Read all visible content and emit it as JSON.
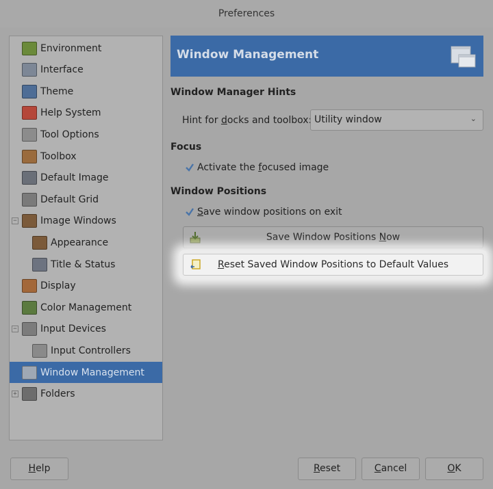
{
  "window": {
    "title": "Preferences"
  },
  "tree": {
    "items": [
      {
        "label": "Environment",
        "icon": "environment-icon",
        "indent": 0,
        "expander": ""
      },
      {
        "label": "Interface",
        "icon": "interface-icon",
        "indent": 0,
        "expander": ""
      },
      {
        "label": "Theme",
        "icon": "theme-icon",
        "indent": 0,
        "expander": ""
      },
      {
        "label": "Help System",
        "icon": "help-system-icon",
        "indent": 0,
        "expander": ""
      },
      {
        "label": "Tool Options",
        "icon": "tool-options-icon",
        "indent": 0,
        "expander": ""
      },
      {
        "label": "Toolbox",
        "icon": "toolbox-icon",
        "indent": 0,
        "expander": ""
      },
      {
        "label": "Default Image",
        "icon": "default-image-icon",
        "indent": 0,
        "expander": ""
      },
      {
        "label": "Default Grid",
        "icon": "default-grid-icon",
        "indent": 0,
        "expander": ""
      },
      {
        "label": "Image Windows",
        "icon": "image-windows-icon",
        "indent": 0,
        "expander": "−"
      },
      {
        "label": "Appearance",
        "icon": "appearance-icon",
        "indent": 1,
        "expander": ""
      },
      {
        "label": "Title & Status",
        "icon": "title-status-icon",
        "indent": 1,
        "expander": ""
      },
      {
        "label": "Display",
        "icon": "display-icon",
        "indent": 0,
        "expander": ""
      },
      {
        "label": "Color Management",
        "icon": "color-management-icon",
        "indent": 0,
        "expander": ""
      },
      {
        "label": "Input Devices",
        "icon": "input-devices-icon",
        "indent": 0,
        "expander": "−"
      },
      {
        "label": "Input Controllers",
        "icon": "input-controllers-icon",
        "indent": 1,
        "expander": ""
      },
      {
        "label": "Window Management",
        "icon": "window-management-icon",
        "indent": 0,
        "expander": "",
        "selected": true
      },
      {
        "label": "Folders",
        "icon": "folders-icon",
        "indent": 0,
        "expander": "+"
      }
    ]
  },
  "banner": {
    "title": "Window Management",
    "icon": "window-management-icon"
  },
  "hints": {
    "section": "Window Manager Hints",
    "label_pre": "Hint for ",
    "label_mn": "d",
    "label_post": "ocks and toolbox:",
    "value": "Utility window"
  },
  "focus": {
    "section": "Focus",
    "activate_pre": "Activate the ",
    "activate_mn": "f",
    "activate_post": "ocused image",
    "activate_checked": true
  },
  "positions": {
    "section": "Window Positions",
    "save_on_exit_mn": "S",
    "save_on_exit_post": "ave window positions on exit",
    "save_on_exit_checked": true,
    "save_now_pre": "Save Window Positions ",
    "save_now_mn": "N",
    "save_now_post": "ow",
    "reset_mn": "R",
    "reset_post": "eset Saved Window Positions to Default Values"
  },
  "footer": {
    "help_mn": "H",
    "help_post": "elp",
    "reset_mn": "R",
    "reset_post": "eset",
    "cancel_mn": "C",
    "cancel_post": "ancel",
    "ok_mn": "O",
    "ok_post": "K"
  },
  "colors": {
    "selection": "#3b6aa6",
    "dim_background": "#a7a7a7",
    "highlight": "#f2f2f2"
  }
}
